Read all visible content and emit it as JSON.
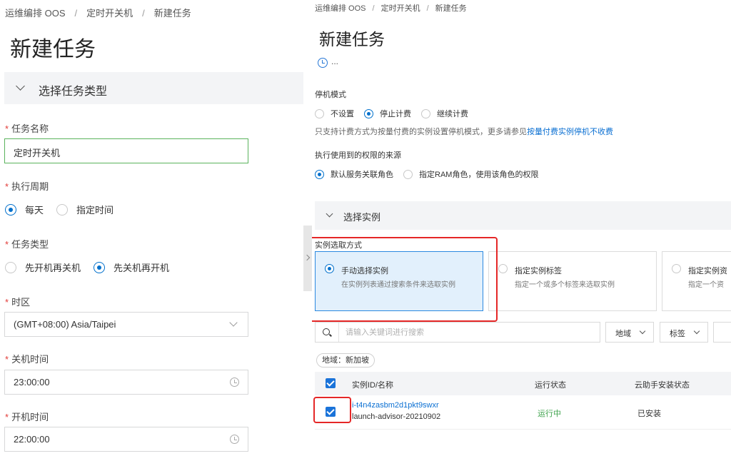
{
  "left": {
    "breadcrumb": [
      "运维编排 OOS",
      "定时开关机",
      "新建任务"
    ],
    "page_title": "新建任务",
    "section_label": "选择任务类型",
    "task_name": {
      "label": "任务名称",
      "value": "定时开关机"
    },
    "schedule": {
      "label": "执行周期",
      "options": [
        "每天",
        "指定时间"
      ],
      "selected": "每天"
    },
    "task_type": {
      "label": "任务类型",
      "options": [
        "先开机再关机",
        "先关机再开机"
      ],
      "selected": "先关机再开机"
    },
    "timezone": {
      "label": "时区",
      "value": "(GMT+08:00) Asia/Taipei"
    },
    "shutdown_time": {
      "label": "关机时间",
      "value": "23:00:00"
    },
    "startup_time": {
      "label": "开机时间",
      "value": "22:00:00"
    },
    "required_mark": "*"
  },
  "right": {
    "breadcrumb": [
      "运维编排 OOS",
      "定时开关机",
      "新建任务"
    ],
    "page_title": "新建任务",
    "time_summary": "...",
    "stop_mode": {
      "label": "停机模式",
      "options": [
        "不设置",
        "停止计费",
        "继续计费"
      ],
      "selected": "停止计费"
    },
    "note_text": "只支持计费方式为按量付费的实例设置停机模式，更多请参见",
    "note_link": "按量付费实例停机不收费",
    "permission": {
      "label": "执行使用到的权限的来源",
      "options": [
        "默认服务关联角色",
        "指定RAM角色，使用该角色的权限"
      ],
      "selected": "默认服务关联角色"
    },
    "section_label": "选择实例",
    "selection_method_label": "实例选取方式",
    "cards": [
      {
        "title": "手动选择实例",
        "desc": "在实例列表通过搜索条件来选取实例",
        "selected": true
      },
      {
        "title": "指定实例标签",
        "desc": "指定一个或多个标签来选取实例",
        "selected": false
      },
      {
        "title": "指定实例资",
        "desc": "指定一个资",
        "selected": false
      }
    ],
    "search_placeholder": "请输入关键词进行搜索",
    "region_dropdown": "地域",
    "tag_dropdown": "标签",
    "filter_chip": "地域：新加坡",
    "table": {
      "columns": [
        "实例ID/名称",
        "运行状态",
        "云助手安装状态"
      ],
      "rows": [
        {
          "id": "i-t4n4zasbm2d1pkt9swxr",
          "name": "launch-advisor-20210902",
          "status": "运行中",
          "assistant": "已安装",
          "checked": true
        }
      ]
    },
    "colors": {
      "accent": "#0070cc",
      "highlight": "#e52727",
      "running": "#3fa34d"
    }
  }
}
